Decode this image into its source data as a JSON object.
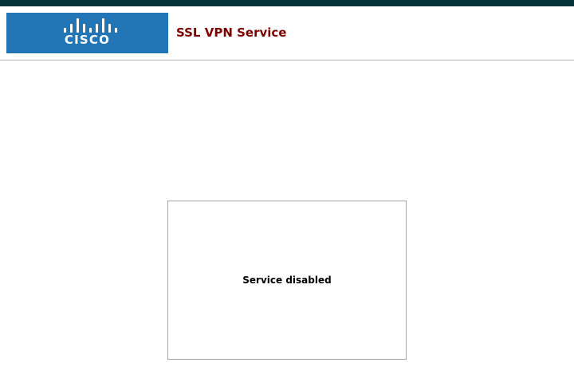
{
  "header": {
    "logo": {
      "wordmark": "CISCO",
      "icon": "cisco-bridge-logo"
    },
    "title": "SSL VPN Service"
  },
  "main": {
    "status_message": "Service disabled"
  },
  "colors": {
    "top_bar": "#04343a",
    "logo_background": "#2376b6",
    "title_text": "#7a0000",
    "divider": "#b3b3b3",
    "panel_border": "#a6a6a6"
  }
}
